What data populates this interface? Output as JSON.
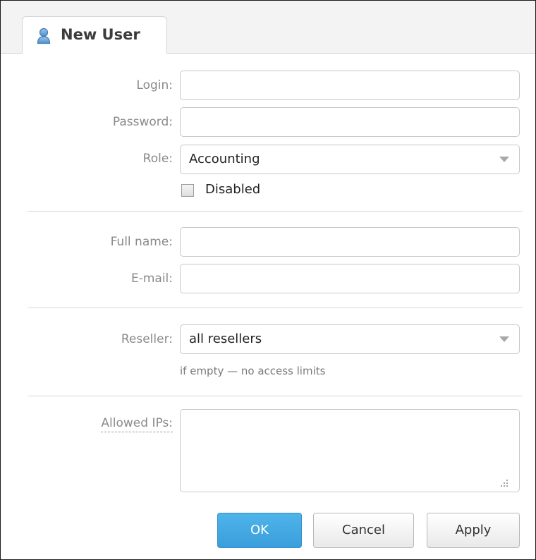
{
  "tab": {
    "title": "New User",
    "icon": "user-icon"
  },
  "form": {
    "login": {
      "label": "Login:",
      "value": ""
    },
    "password": {
      "label": "Password:",
      "value": ""
    },
    "role": {
      "label": "Role:",
      "value": "Accounting"
    },
    "disabled": {
      "label": "Disabled",
      "checked": false
    },
    "full_name": {
      "label": "Full name:",
      "value": ""
    },
    "email": {
      "label": "E-mail:",
      "value": ""
    },
    "reseller": {
      "label": "Reseller:",
      "value": "all resellers",
      "hint": "if empty — no access limits"
    },
    "allowed_ips": {
      "label": "Allowed IPs:",
      "value": ""
    }
  },
  "buttons": {
    "ok": "OK",
    "cancel": "Cancel",
    "apply": "Apply"
  },
  "colors": {
    "primary": "#3a9edb",
    "label": "#8a8a8a",
    "border": "#c8c8c8"
  }
}
